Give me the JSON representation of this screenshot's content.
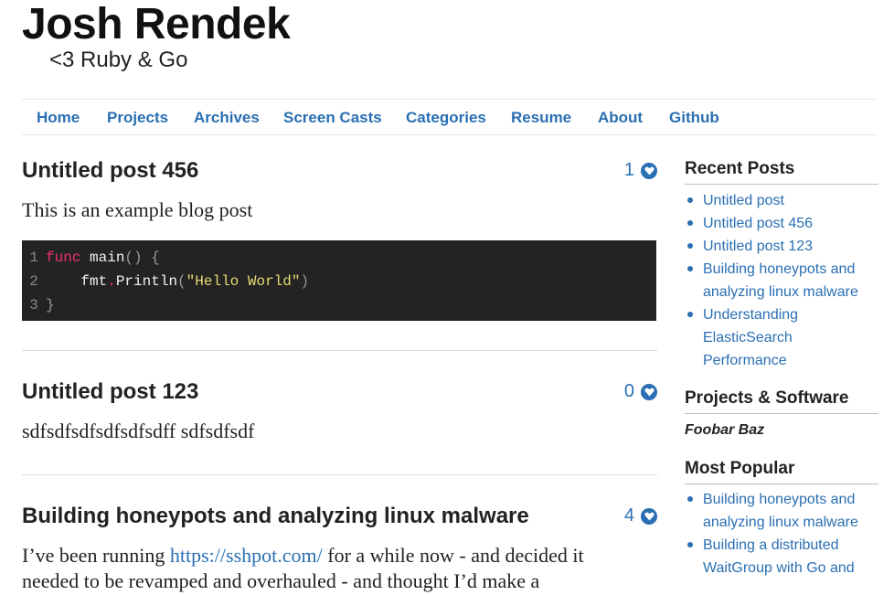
{
  "site": {
    "title": "Josh Rendek",
    "subtitle": "<3 Ruby & Go"
  },
  "nav": {
    "items": [
      "Home",
      "Projects",
      "Archives",
      "Screen Casts",
      "Categories",
      "Resume",
      "About",
      "Github"
    ]
  },
  "posts": [
    {
      "title": "Untitled post 456",
      "comment_count": "1",
      "body": "This is an example blog post",
      "code": {
        "line_numbers": [
          "1",
          "2",
          "3"
        ],
        "line1": {
          "keyword": "func",
          "name": "main",
          "punct": "() {"
        },
        "line2": {
          "obj": "fmt",
          "dot": ".",
          "method": "Println",
          "open": "(",
          "string": "\"Hello World\"",
          "close": ")"
        },
        "line3": {
          "punct": "}"
        }
      }
    },
    {
      "title": "Untitled post 123",
      "comment_count": "0",
      "body": "sdfsdfsdfsdfsdfsdff sdfsdfsdf"
    },
    {
      "title": "Building honeypots and analyzing linux malware",
      "comment_count": "4",
      "body_prefix": "I’ve been running ",
      "body_link": "https://sshpot.com/",
      "body_suffix": " for a while now - and decided it",
      "body_line2": "needed to be revamped and overhauled - and thought I’d make a"
    }
  ],
  "sidebar": {
    "recent_posts": {
      "heading": "Recent Posts",
      "items": [
        [
          "Untitled post"
        ],
        [
          "Untitled post 456"
        ],
        [
          "Untitled post 123"
        ],
        [
          "Building honeypots and",
          "analyzing linux malware"
        ],
        [
          "Understanding",
          "ElasticSearch",
          "Performance"
        ]
      ]
    },
    "projects": {
      "heading": "Projects & Software",
      "item": "Foobar Baz"
    },
    "most_popular": {
      "heading": "Most Popular",
      "items": [
        [
          "Building honeypots and",
          "analyzing linux malware"
        ],
        [
          "Building a distributed",
          "WaitGroup with Go and"
        ]
      ]
    }
  },
  "colors": {
    "link": "#2a6fb3",
    "code_bg": "#232323",
    "keyword": "#f02f6a",
    "string": "#e6db74"
  }
}
